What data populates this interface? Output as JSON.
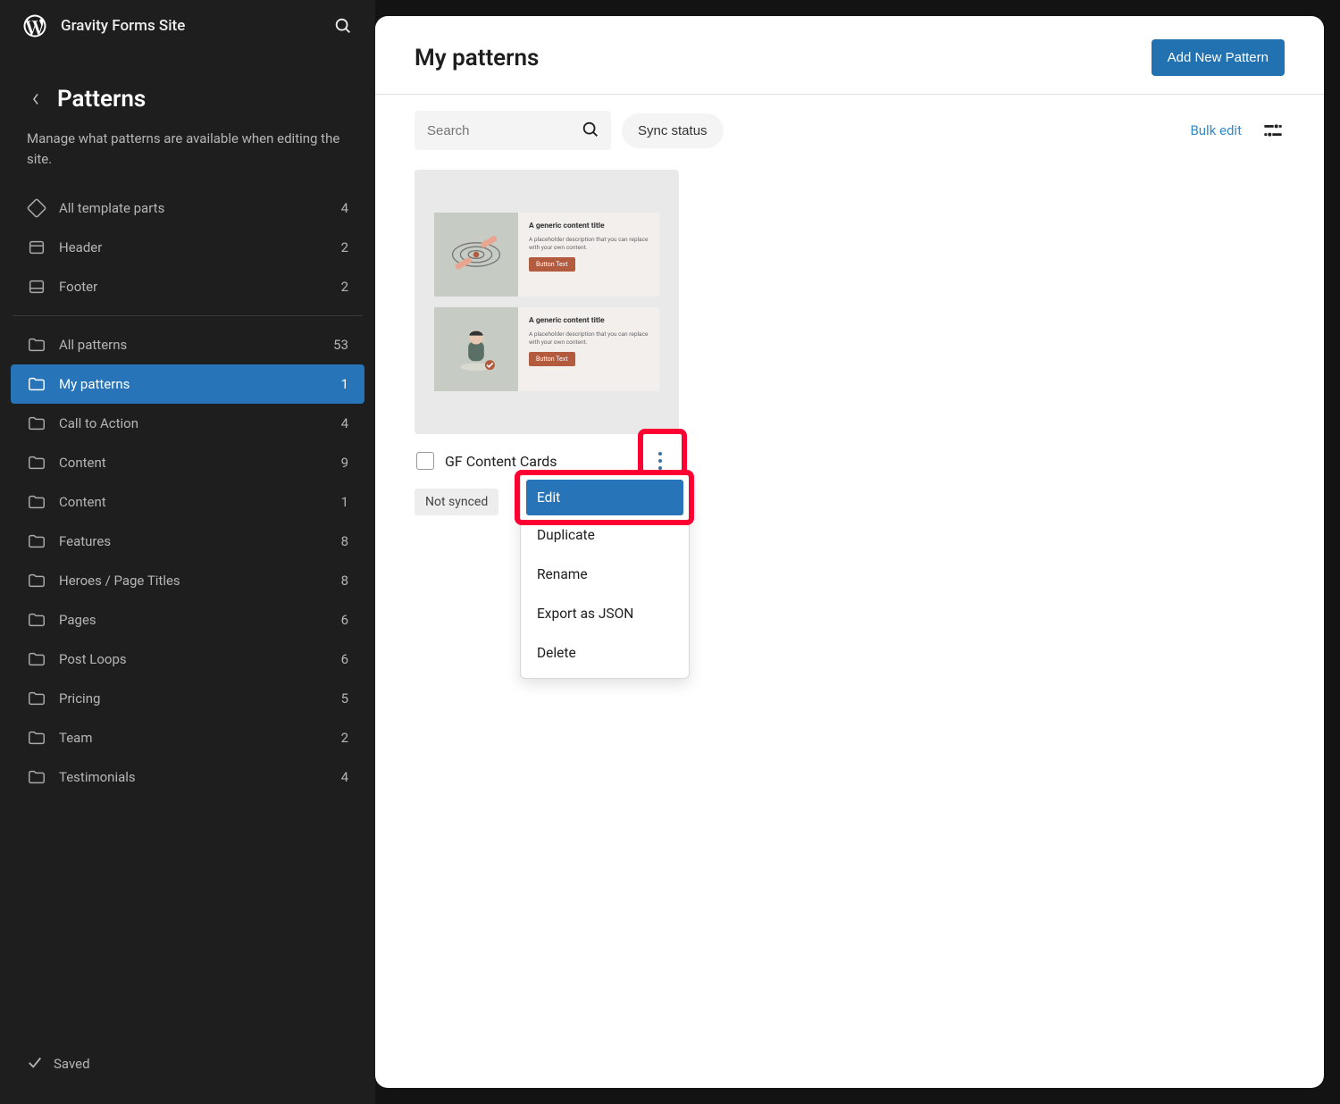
{
  "topbar": {
    "site_name": "Gravity Forms Site"
  },
  "sidebar": {
    "title": "Patterns",
    "description": "Manage what patterns are available when editing the site.",
    "template_parts": [
      {
        "label": "All template parts",
        "count": "4",
        "icon": "template"
      },
      {
        "label": "Header",
        "count": "2",
        "icon": "header"
      },
      {
        "label": "Footer",
        "count": "2",
        "icon": "footer"
      }
    ],
    "pattern_groups": [
      {
        "label": "All patterns",
        "count": "53"
      },
      {
        "label": "My patterns",
        "count": "1",
        "active": true
      },
      {
        "label": "Call to Action",
        "count": "4"
      },
      {
        "label": "Content",
        "count": "9"
      },
      {
        "label": "Content",
        "count": "1"
      },
      {
        "label": "Features",
        "count": "8"
      },
      {
        "label": "Heroes / Page Titles",
        "count": "8"
      },
      {
        "label": "Pages",
        "count": "6"
      },
      {
        "label": "Post Loops",
        "count": "6"
      },
      {
        "label": "Pricing",
        "count": "5"
      },
      {
        "label": "Team",
        "count": "2"
      },
      {
        "label": "Testimonials",
        "count": "4"
      }
    ]
  },
  "status": {
    "label": "Saved"
  },
  "main": {
    "title": "My patterns",
    "add_button": "Add New Pattern",
    "search_placeholder": "Search",
    "sync_chip": "Sync status",
    "bulk_edit": "Bulk edit"
  },
  "patterns": [
    {
      "name": "GF Content Cards",
      "tag": "Not synced",
      "preview_cards": [
        {
          "title": "A generic content title",
          "desc": "A placeholder description that you can replace with your own content.",
          "button": "Button Text"
        },
        {
          "title": "A generic content title",
          "desc": "A placeholder description that you can replace with your own content.",
          "button": "Button Text"
        }
      ]
    }
  ],
  "dropdown": {
    "items": [
      {
        "label": "Edit",
        "selected": true
      },
      {
        "label": "Duplicate"
      },
      {
        "label": "Rename"
      },
      {
        "label": "Export as JSON"
      },
      {
        "label": "Delete"
      }
    ]
  }
}
